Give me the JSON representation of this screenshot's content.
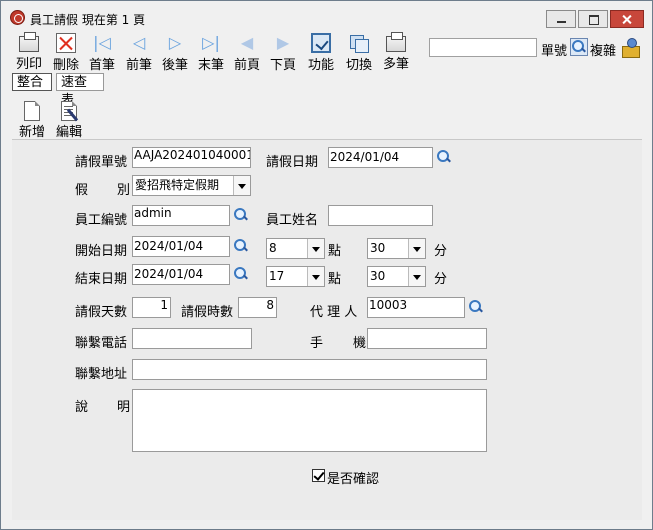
{
  "window": {
    "title": "員工請假  現在第 1 頁",
    "controls": {
      "minimize": "minimize-icon",
      "maximize": "maximize-icon",
      "close": "close-icon"
    }
  },
  "toolbar": {
    "items": [
      {
        "label": "列印",
        "icon": "printer-icon"
      },
      {
        "label": "刪除",
        "icon": "delete-icon"
      },
      {
        "label": "首筆",
        "icon": "first-record-icon"
      },
      {
        "label": "前筆",
        "icon": "prev-record-icon"
      },
      {
        "label": "後筆",
        "icon": "next-record-icon"
      },
      {
        "label": "末筆",
        "icon": "last-record-icon"
      },
      {
        "label": "前頁",
        "icon": "prev-page-icon"
      },
      {
        "label": "下頁",
        "icon": "next-page-icon"
      },
      {
        "label": "功能",
        "icon": "function-icon"
      },
      {
        "label": "切換",
        "icon": "switch-icon"
      },
      {
        "label": "多筆",
        "icon": "multi-record-icon"
      }
    ],
    "search_value": "",
    "label_dan": "單號",
    "label_fuza": "複雜"
  },
  "tabs": [
    "整合",
    "速查表"
  ],
  "actions": {
    "new_label": "新增",
    "edit_label": "編輯"
  },
  "form": {
    "leave_no_label": "請假單號",
    "leave_no_value": "AAJA202401040001",
    "leave_date_label": "請假日期",
    "leave_date_value": "2024/01/04",
    "leave_type_label_1": "假",
    "leave_type_label_2": "別",
    "leave_type_value": "愛招飛特定假期",
    "emp_no_label": "員工編號",
    "emp_no_value": "admin",
    "emp_name_label": "員工姓名",
    "emp_name_value": "",
    "start_date_label": "開始日期",
    "start_date_value": "2024/01/04",
    "start_hour_value": "8",
    "start_min_value": "30",
    "end_date_label": "結束日期",
    "end_date_value": "2024/01/04",
    "end_hour_value": "17",
    "end_min_value": "30",
    "hour_unit": "點",
    "min_unit": "分",
    "days_label": "請假天數",
    "days_value": "1",
    "hours_label": "請假時數",
    "hours_value": "8",
    "agent_label": "代 理 人",
    "agent_value": "10003",
    "phone_label": "聯繫電話",
    "phone_value": "",
    "mobile_label_1": "手",
    "mobile_label_2": "機",
    "mobile_value": "",
    "address_label": "聯繫地址",
    "address_value": "",
    "desc_label_1": "說",
    "desc_label_2": "明",
    "desc_value": "",
    "confirm_label": "是否確認",
    "confirm_checked": true
  }
}
